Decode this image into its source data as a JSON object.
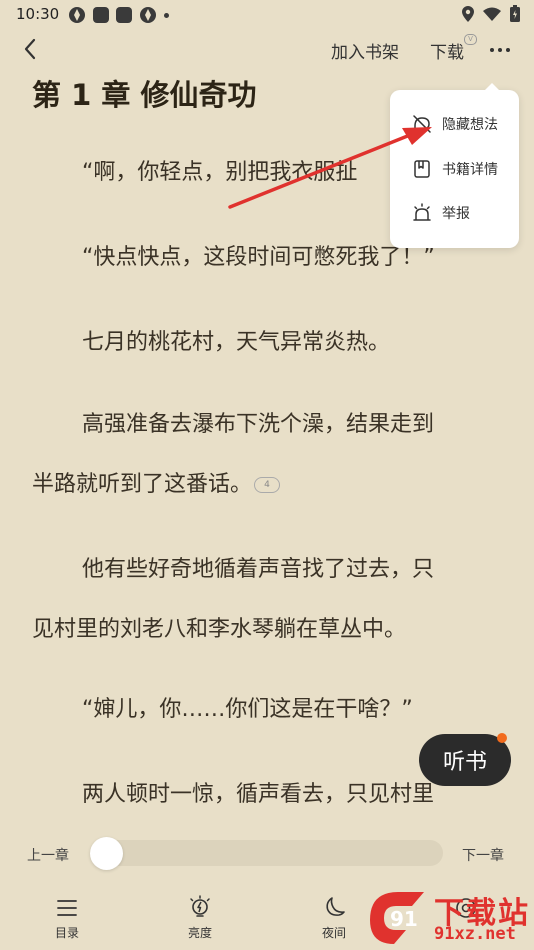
{
  "status_bar": {
    "time": "10:30"
  },
  "top_bar": {
    "add_to_shelf": "加入书架",
    "download": "下载",
    "download_badge": "V"
  },
  "content": {
    "chapter_title": "第 1 章 修仙奇功",
    "paragraphs": [
      "“啊，你轻点，别把我衣服扯",
      "“快点快点，这段时间可憋死我了！”",
      "七月的桃花村，天气异常炎热。",
      "高强准备去瀑布下洗个澡，结果走到",
      "半路就听到了这番话。",
      "他有些好奇地循着声音找了过去，只",
      "见村里的刘老八和李水琴躺在草丛中。",
      "“婶儿，你……你们这是在干啥？”",
      "两人顿时一惊，循声看去，只见村里"
    ],
    "comment_count": "4"
  },
  "popup_menu": {
    "items": [
      {
        "label": "隐藏想法",
        "icon": "hide-thoughts-icon"
      },
      {
        "label": "书籍详情",
        "icon": "book-details-icon"
      },
      {
        "label": "举报",
        "icon": "report-alarm-icon"
      }
    ]
  },
  "listen_button": {
    "label": "听书"
  },
  "progress": {
    "prev_label": "上一章",
    "next_label": "下一章",
    "value": 0
  },
  "bottom_nav": {
    "items": [
      {
        "label": "目录",
        "icon": "list-icon"
      },
      {
        "label": "亮度",
        "icon": "brightness-icon"
      },
      {
        "label": "夜间",
        "icon": "moon-icon"
      }
    ]
  },
  "watermark": {
    "title": "下载站",
    "site": "91xz.net",
    "logo": "91"
  },
  "colors": {
    "background": "#e8dfc8",
    "accent": "#f26b1d",
    "arrow": "#e0322e"
  }
}
